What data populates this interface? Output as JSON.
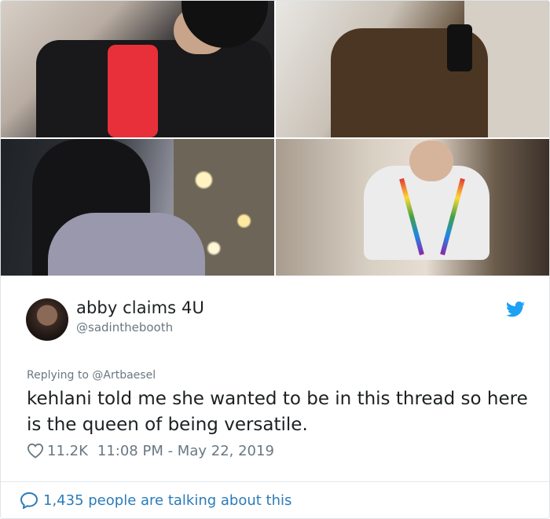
{
  "photos": {
    "count": 4,
    "items": [
      {
        "label": "photo-top-left"
      },
      {
        "label": "photo-top-right"
      },
      {
        "label": "photo-bottom-left"
      },
      {
        "label": "photo-bottom-right"
      }
    ]
  },
  "tweet": {
    "display_name": "abby claims 4U",
    "handle": "@sadinthebooth",
    "replying_prefix": "Replying to",
    "replying_to": "@Artbaesel",
    "text": "kehlani told me she wanted to be in this thread so here is the queen of being versatile.",
    "likes": "11.2K",
    "timestamp": "11:08 PM - May 22, 2019",
    "talking": "1,435 people are talking about this"
  },
  "icons": {
    "brand": "twitter-bird-icon",
    "like": "heart-icon",
    "conversation": "speech-bubble-icon"
  },
  "colors": {
    "twitter_blue": "#1da1f2",
    "link_blue": "#2b7bb9",
    "text_primary": "#1c2022",
    "text_secondary": "#697882",
    "border": "#e1e8ed"
  }
}
